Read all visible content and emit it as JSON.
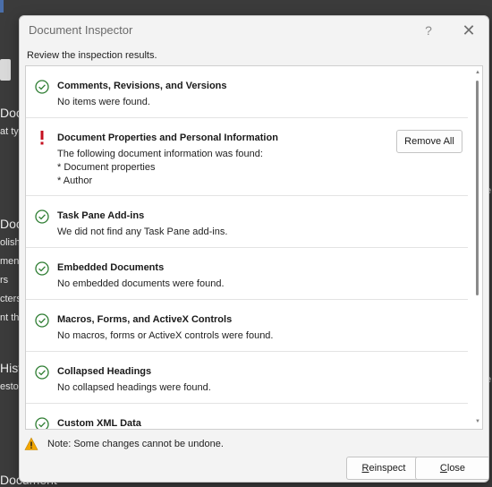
{
  "background": {
    "fragments": [
      "Doc",
      "at ty",
      "Doc",
      "olishi",
      "ment",
      "rs",
      "cters",
      "nt th",
      "Hist",
      "esto",
      "Document",
      "e",
      "e"
    ]
  },
  "dialog": {
    "title": "Document Inspector",
    "help_glyph": "?",
    "close_glyph": "✕",
    "subtitle": "Review the inspection results.",
    "items": [
      {
        "status": "ok",
        "name": "Comments, Revisions, and Versions",
        "description": "No items were found."
      },
      {
        "status": "found",
        "name": "Document Properties and Personal Information",
        "description": "The following document information was found:",
        "details": [
          "* Document properties",
          "* Author"
        ],
        "action_label": "Remove All"
      },
      {
        "status": "ok",
        "name": "Task Pane Add-ins",
        "description": "We did not find any Task Pane add-ins."
      },
      {
        "status": "ok",
        "name": "Embedded Documents",
        "description": "No embedded documents were found."
      },
      {
        "status": "ok",
        "name": "Macros, Forms, and ActiveX Controls",
        "description": "No macros, forms or ActiveX controls were found."
      },
      {
        "status": "ok",
        "name": "Collapsed Headings",
        "description": "No collapsed headings were found."
      },
      {
        "status": "ok",
        "name": "Custom XML Data",
        "description": ""
      }
    ],
    "note": "Note: Some changes cannot be undone.",
    "reinspect": {
      "mnemonic": "R",
      "rest": "einspect"
    },
    "close": {
      "mnemonic": "C",
      "rest": "lose"
    },
    "colors": {
      "ok": "#2e7d32",
      "found": "#c50f1f",
      "warn": "#f2a600"
    }
  }
}
